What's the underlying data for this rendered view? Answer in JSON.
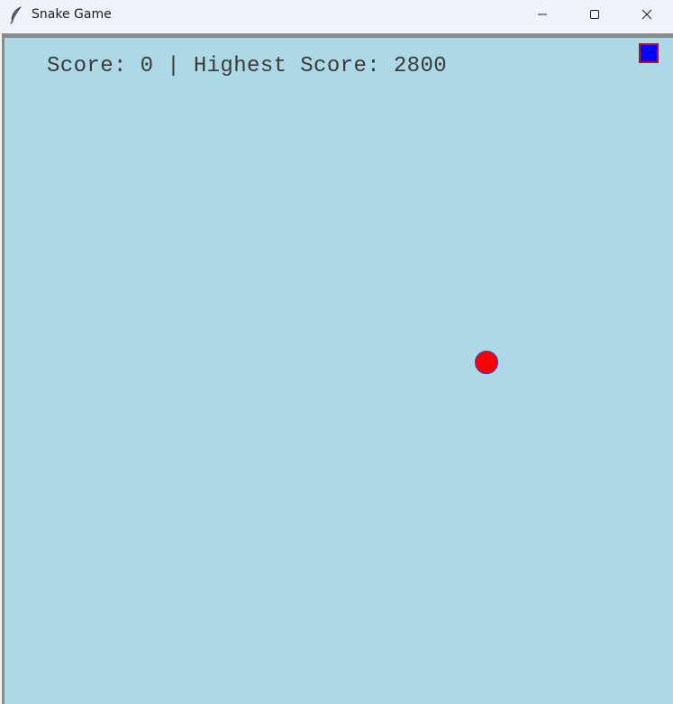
{
  "window": {
    "title": "Snake Game",
    "icon": "feather-icon",
    "controls": {
      "minimize": "minimize-icon",
      "maximize": "maximize-icon",
      "close": "close-icon"
    }
  },
  "game": {
    "score_text": "Score: 0 | Highest Score: 2800",
    "colors": {
      "background": "#add8e6",
      "snake_fill": "#0000ff",
      "snake_outline": "#b01030",
      "food_fill": "#ff0000",
      "food_outline": "#3b3bd0",
      "score_text": "#3a3a3a"
    }
  }
}
